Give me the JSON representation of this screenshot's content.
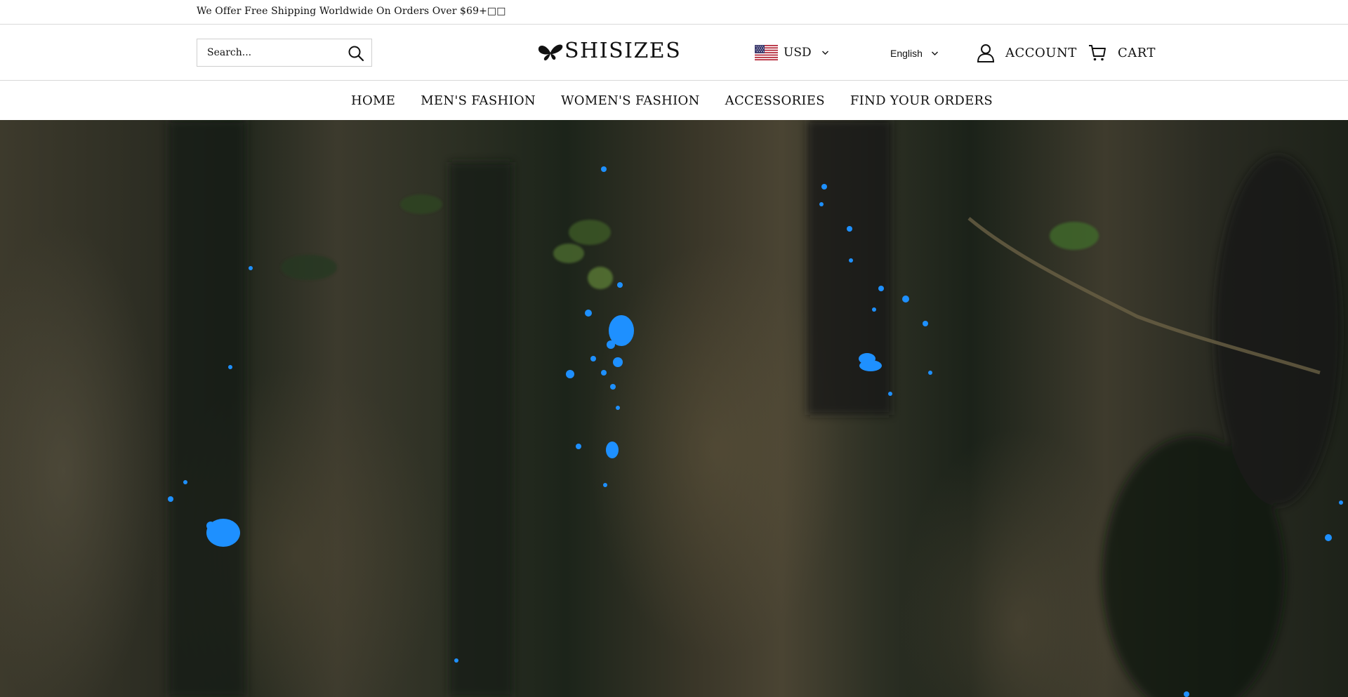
{
  "announcement": {
    "text": "We Offer Free Shipping Worldwide On Orders Over $69+□□"
  },
  "header": {
    "search": {
      "placeholder": "Search..."
    },
    "logo_text": "SHISIZES",
    "currency": {
      "code": "USD",
      "flag": "us-flag-icon"
    },
    "language": {
      "label": "English"
    },
    "account_label": "ACCOUNT",
    "cart_label": "CART"
  },
  "nav": {
    "items": [
      {
        "label": "HOME"
      },
      {
        "label": "MEN'S FASHION"
      },
      {
        "label": "WOMEN'S FASHION"
      },
      {
        "label": "ACCESSORIES"
      },
      {
        "label": "FIND YOUR ORDERS"
      }
    ]
  },
  "colors": {
    "text": "#111111",
    "border": "#d9d9d9",
    "glow": "#1e90ff"
  }
}
